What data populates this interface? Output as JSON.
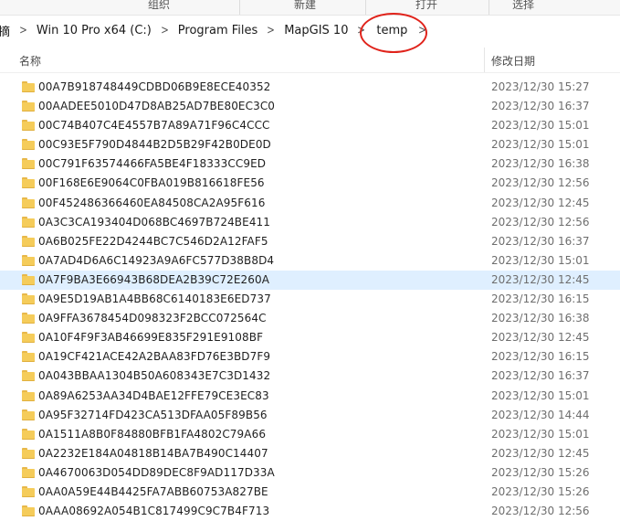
{
  "ribbon": {
    "organize": "组织",
    "new": "新建",
    "open": "打开",
    "select": "选择"
  },
  "address": {
    "crumbs": [
      "摘",
      "Win 10 Pro x64 (C:)",
      "Program Files",
      "MapGIS 10",
      "temp"
    ]
  },
  "annotation_color": "#e0231b",
  "columns": {
    "name": "名称",
    "date": "修改日期"
  },
  "files": [
    {
      "name": "00A7B918748449CDBD06B9E8ECE40352",
      "date": "2023/12/30 15:27"
    },
    {
      "name": "00AADEE5010D47D8AB25AD7BE80EC3C0",
      "date": "2023/12/30 16:37"
    },
    {
      "name": "00C74B407C4E4557B7A89A71F96C4CCC",
      "date": "2023/12/30 15:01"
    },
    {
      "name": "00C93E5F790D4844B2D5B29F42B0DE0D",
      "date": "2023/12/30 15:01"
    },
    {
      "name": "00C791F63574466FA5BE4F18333CC9ED",
      "date": "2023/12/30 16:38"
    },
    {
      "name": "00F168E6E9064C0FBA019B816618FE56",
      "date": "2023/12/30 12:56"
    },
    {
      "name": "00F452486366460EA84508CA2A95F616",
      "date": "2023/12/30 12:45"
    },
    {
      "name": "0A3C3CA193404D068BC4697B724BE411",
      "date": "2023/12/30 12:56"
    },
    {
      "name": "0A6B025FE22D4244BC7C546D2A12FAF5",
      "date": "2023/12/30 16:37"
    },
    {
      "name": "0A7AD4D6A6C14923A9A6FC577D38B8D4",
      "date": "2023/12/30 15:01"
    },
    {
      "name": "0A7F9BA3E66943B68DEA2B39C72E260A",
      "date": "2023/12/30 12:45",
      "selected": true
    },
    {
      "name": "0A9E5D19AB1A4BB68C6140183E6ED737",
      "date": "2023/12/30 16:15"
    },
    {
      "name": "0A9FFA3678454D098323F2BCC072564C",
      "date": "2023/12/30 16:38"
    },
    {
      "name": "0A10F4F9F3AB46699E835F291E9108BF",
      "date": "2023/12/30 12:45"
    },
    {
      "name": "0A19CF421ACE42A2BAA83FD76E3BD7F9",
      "date": "2023/12/30 16:15"
    },
    {
      "name": "0A043BBAA1304B50A608343E7C3D1432",
      "date": "2023/12/30 16:37"
    },
    {
      "name": "0A89A6253AA34D4BAE12FFE79CE3EC83",
      "date": "2023/12/30 15:01"
    },
    {
      "name": "0A95F32714FD423CA513DFAA05F89B56",
      "date": "2023/12/30 14:44"
    },
    {
      "name": "0A1511A8B0F84880BFB1FA4802C79A66",
      "date": "2023/12/30 15:01"
    },
    {
      "name": "0A2232E184A04818B14BA7B490C14407",
      "date": "2023/12/30 12:45"
    },
    {
      "name": "0A4670063D054DD89DEC8F9AD117D33A",
      "date": "2023/12/30 15:26"
    },
    {
      "name": "0AA0A59E44B4425FA7ABB60753A827BE",
      "date": "2023/12/30 15:26"
    },
    {
      "name": "0AAA08692A054B1C817499C9C7B4F713",
      "date": "2023/12/30 12:56"
    }
  ]
}
